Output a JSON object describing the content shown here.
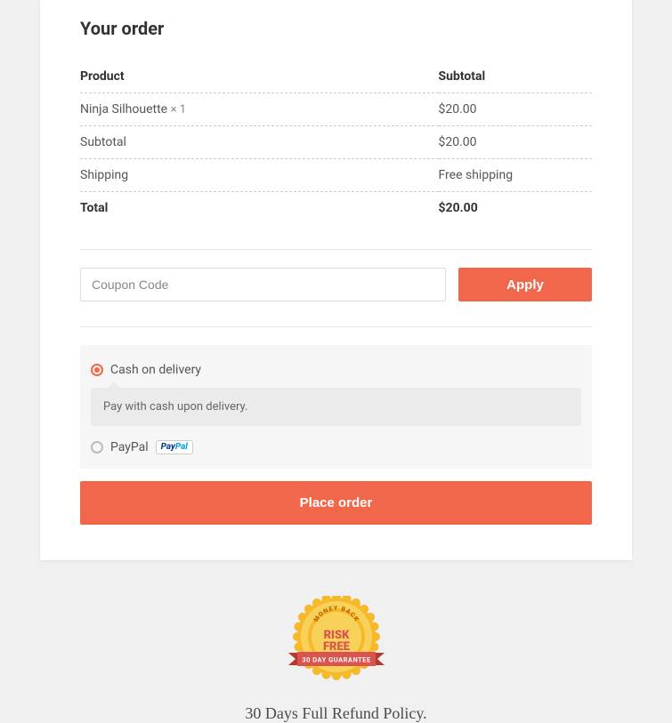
{
  "order": {
    "title": "Your order",
    "headers": {
      "product": "Product",
      "subtotal": "Subtotal"
    },
    "items": [
      {
        "name": "Ninja Silhouette",
        "qty": "× 1",
        "subtotal": "$20.00"
      }
    ],
    "subtotal": {
      "label": "Subtotal",
      "value": "$20.00"
    },
    "shipping": {
      "label": "Shipping",
      "value": "Free shipping"
    },
    "total": {
      "label": "Total",
      "value": "$20.00"
    }
  },
  "coupon": {
    "placeholder": "Coupon Code",
    "apply_label": "Apply"
  },
  "payment": {
    "options": [
      {
        "label": "Cash on delivery",
        "description": "Pay with cash upon delivery.",
        "selected": true
      },
      {
        "label": "PayPal",
        "selected": false
      }
    ],
    "place_order_label": "Place order"
  },
  "guarantee": {
    "badge": {
      "top_text": "MONEY BACK",
      "main1": "RISK",
      "main2": "FREE",
      "ribbon": "30 DAY GUARANTEE"
    },
    "policy_text": "30 Days Full Refund Policy."
  }
}
